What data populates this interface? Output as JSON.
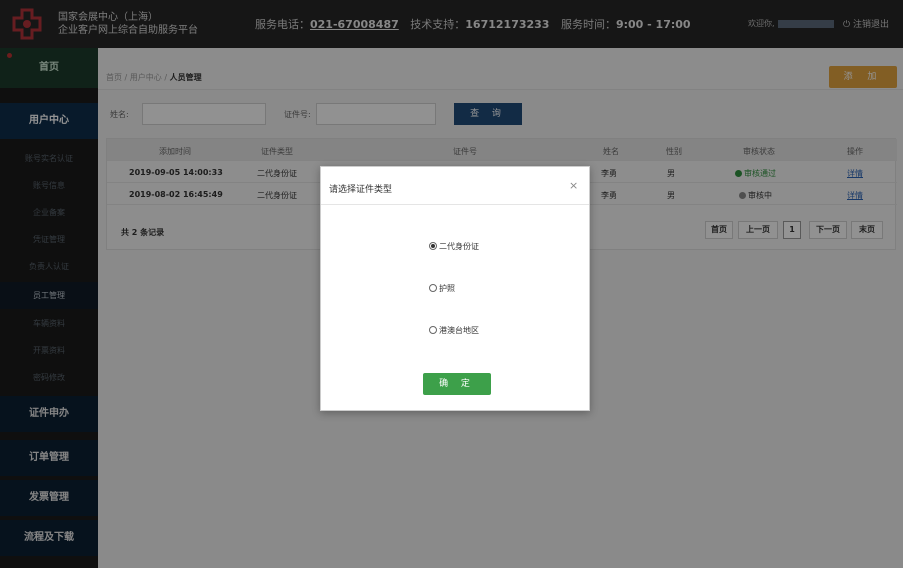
{
  "header": {
    "brand_line1": "国家会展中心（上海）",
    "brand_line2": "企业客户网上综合自助服务平台",
    "hotline_label": "服务电话：",
    "hotline_number": "021-67008487",
    "support_label": "技术支持：",
    "support_number": "16712173233",
    "hours_label": "服务时间：",
    "hours_value": "9:00 - 17:00",
    "welcome": "欢迎你,",
    "logout": "⏻ 注销退出"
  },
  "sidebar": {
    "home": "首页",
    "groups": [
      {
        "label": "用户中心"
      },
      {
        "label": "证件申办"
      },
      {
        "label": "订单管理"
      },
      {
        "label": "发票管理"
      },
      {
        "label": "流程及下载"
      }
    ],
    "sub_items": [
      {
        "label": "账号实名认证"
      },
      {
        "label": "账号信息"
      },
      {
        "label": "企业备案"
      },
      {
        "label": "凭证管理"
      },
      {
        "label": "负责人认证"
      },
      {
        "label": "员工管理"
      },
      {
        "label": "车辆资料"
      },
      {
        "label": "开票资料"
      },
      {
        "label": "密码修改"
      }
    ]
  },
  "breadcrumb": {
    "home": "首页",
    "sep1": "/",
    "parent": "用户中心",
    "sep2": "/",
    "current": "人员管理"
  },
  "actions": {
    "add": "添 加"
  },
  "filter": {
    "name_label": "姓名:",
    "cert_label": "证件号:",
    "query": "查 询"
  },
  "table": {
    "headers": [
      "添加时间",
      "证件类型",
      "证件号",
      "姓名",
      "性别",
      "审核状态",
      "操作"
    ],
    "rows": [
      {
        "time": "2019-09-05 14:00:33",
        "type": "二代身份证",
        "name": "李勇",
        "gender": "男",
        "status": "审核通过",
        "action": "详情"
      },
      {
        "time": "2019-08-02 16:45:49",
        "type": "二代身份证",
        "name": "李勇",
        "gender": "男",
        "status": "审核中",
        "action": "详情"
      }
    ],
    "total": "共 2 条记录",
    "pager": {
      "first": "首页",
      "prev": "上一页",
      "page": "1",
      "next": "下一页",
      "last": "末页"
    }
  },
  "modal": {
    "title": "请选择证件类型",
    "close": "×",
    "options": [
      {
        "label": "二代身份证",
        "selected": true
      },
      {
        "label": "护照",
        "selected": false
      },
      {
        "label": "港澳台地区",
        "selected": false
      }
    ],
    "confirm": "确 定"
  },
  "colors": {
    "header_bg": "#262626",
    "sidebar_bg": "#0b1f33",
    "add_button": "#e0a23f",
    "query_button": "#1f4a78",
    "confirm_button": "#3da04a",
    "status_ok": "#2f8f3e"
  }
}
